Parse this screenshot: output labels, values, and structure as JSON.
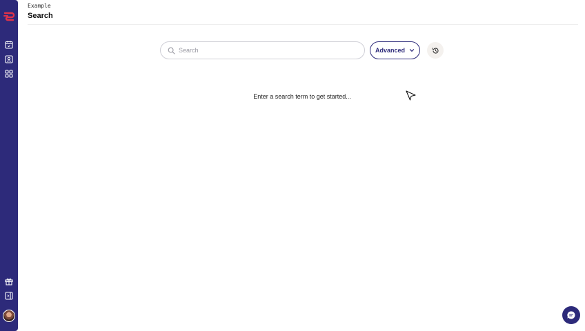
{
  "header": {
    "breadcrumb": "Example",
    "title": "Search"
  },
  "search": {
    "placeholder": "Search",
    "value": ""
  },
  "toolbar": {
    "advanced_label": "Advanced"
  },
  "main": {
    "empty_message": "Enter a search term to get started..."
  },
  "sidebar": {
    "icons": [
      "logo-icon",
      "calendar-icon",
      "contact-card-icon",
      "grid-icon",
      "gift-icon",
      "panel-toggle-icon",
      "avatar"
    ]
  },
  "colors": {
    "sidebar": "#2d2a7a",
    "accent": "#2d2a7a",
    "logo": "#e0334a",
    "history_bg": "#f4f1ee"
  }
}
